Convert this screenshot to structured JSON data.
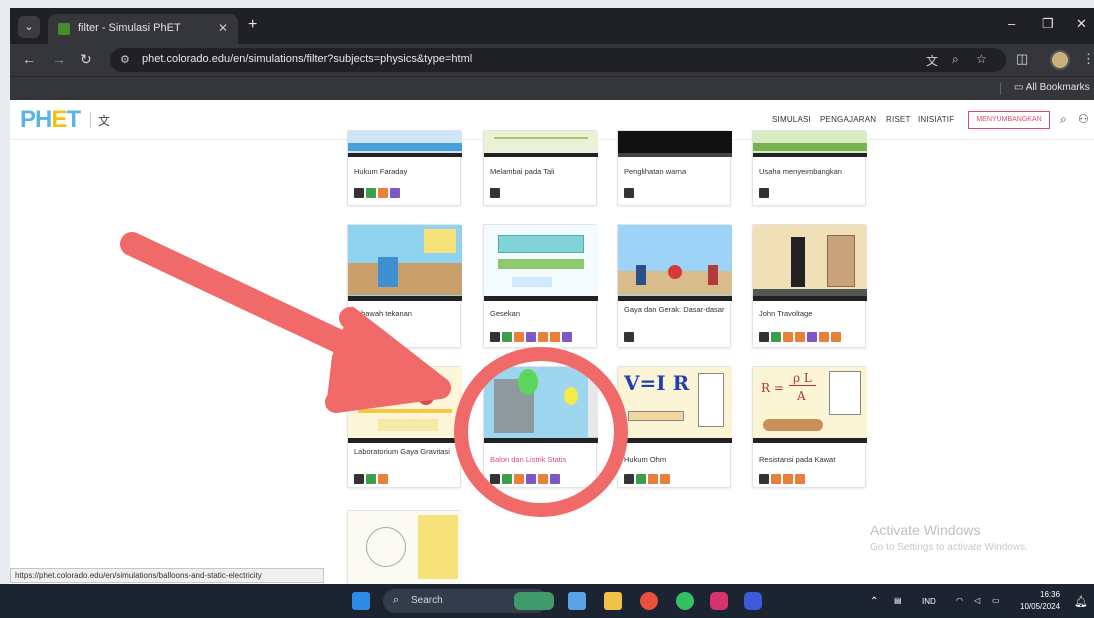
{
  "browser": {
    "tab_title": "filter - Simulasi PhET",
    "tab_close": "✕",
    "new_tab": "+",
    "url": "phet.colorado.edu/en/simulations/filter?subjects=physics&type=html",
    "bookmarks_folder": "All Bookmarks",
    "window_controls": [
      "–",
      "❐",
      "✕"
    ]
  },
  "header": {
    "logo_ph": "PH",
    "logo_e": "E",
    "logo_t": "T",
    "nav": [
      "SIMULASI",
      "PENGAJARAN",
      "RISET",
      "INISIATIF"
    ],
    "donate": "MENYUMBANGKAN"
  },
  "cards": [
    {
      "title": "Hukum Faraday",
      "active": false
    },
    {
      "title": "Melambai pada Tali",
      "active": false
    },
    {
      "title": "Penglihatan warna",
      "active": false
    },
    {
      "title": "Usaha menyeimbangkan",
      "active": false
    },
    {
      "title": "Dibawah tekanan",
      "active": false
    },
    {
      "title": "Gesekan",
      "active": false
    },
    {
      "title": "Gaya dan Gerak: Dasar-dasar",
      "active": false
    },
    {
      "title": "John Travoltage",
      "active": false
    },
    {
      "title": "Laboratorium Gaya Gravitasi",
      "active": false
    },
    {
      "title": "Balon dan Listrik Statis",
      "active": true
    },
    {
      "title": "Hukum Ohm",
      "active": false
    },
    {
      "title": "Resistansi pada Kawat",
      "active": false
    }
  ],
  "thumb_text": {
    "ohm": "V=I R",
    "resist_r": "R = ",
    "resist_frac_top": "ρ L",
    "resist_frac_bot": "A"
  },
  "status_url": "https://phet.colorado.edu/en/simulations/balloons-and-static-electricity",
  "watermark": {
    "title": "Activate Windows",
    "subtitle": "Go to Settings to activate Windows."
  },
  "taskbar": {
    "search": "Search",
    "lang": "IND",
    "time": "16:36",
    "date": "10/05/2024"
  },
  "colors": {
    "phet_blue": "#5ab4e6",
    "phet_yellow": "#f4c20d",
    "donate_pink": "#e14b6b",
    "annotation_red": "#f06a6a"
  }
}
